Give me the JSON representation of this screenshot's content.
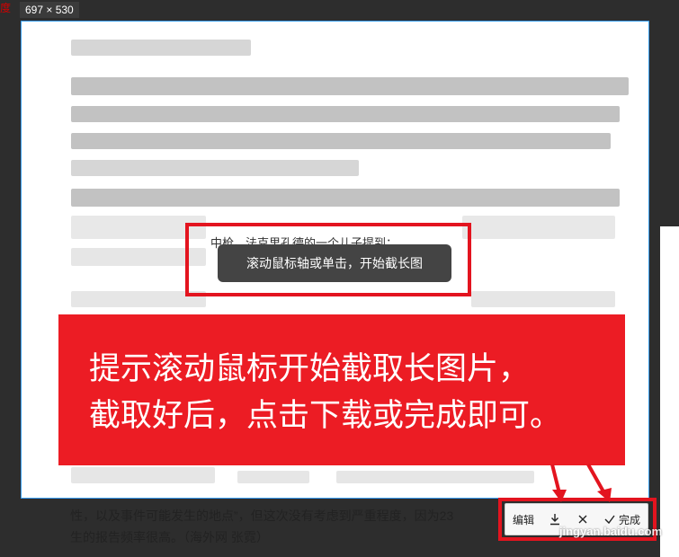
{
  "top_left_char": "度",
  "size_badge": "697 × 530",
  "capture": {
    "visible_line": "中枪。法克里孔德的一个儿子提到："
  },
  "tooltip": {
    "text": "滚动鼠标轴或单击，开始截长图"
  },
  "annotation": {
    "line1": "提示滚动鼠标开始截取长图片，",
    "line2": "截取好后，点击下载或完成即可。"
  },
  "page_text": {
    "line1": "性，以及事件可能发生的地点”，但这次没有考虑到严重程度，因为23",
    "line2_main": "生的报告频率很高。（海外网 张霓）"
  },
  "toolbar": {
    "edit_label": "编辑",
    "download_icon": "download-icon",
    "close_icon": "close-icon",
    "check_icon": "check-icon",
    "done_label": "完成"
  },
  "watermark": "jingyan.baidu.com",
  "colors": {
    "accent_red": "#ec1c24",
    "selection_blue": "#3aa0ff",
    "tooltip_bg": "#444444"
  }
}
